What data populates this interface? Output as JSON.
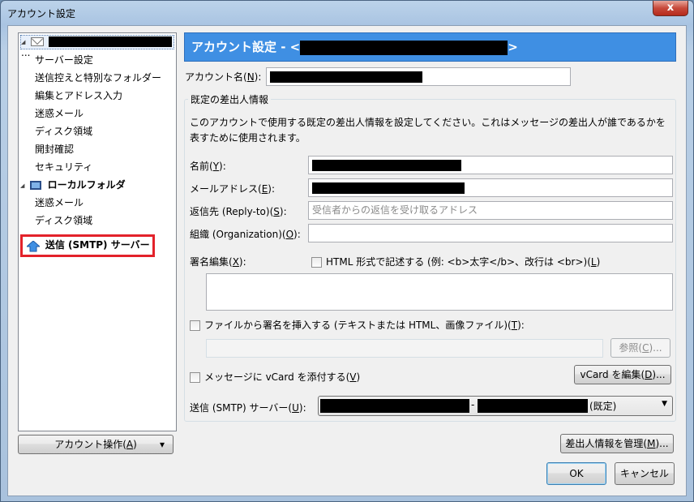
{
  "window": {
    "title": "アカウント設定",
    "close_glyph": "x"
  },
  "tree": {
    "account_ellipsis": "...",
    "account_children": [
      "サーバー設定",
      "送信控えと特別なフォルダー",
      "編集とアドレス入力",
      "迷惑メール",
      "ディスク領域",
      "開封確認",
      "セキュリティ"
    ],
    "local_folder": "ローカルフォルダ",
    "local_children": [
      "迷惑メール",
      "ディスク領域"
    ],
    "smtp": "送信 (SMTP) サーバー"
  },
  "header": {
    "prefix": "アカウント設定 - <",
    "suffix": ">"
  },
  "account_name": {
    "label_pre": "アカウント名(",
    "key": "N",
    "label_post": "):"
  },
  "identity": {
    "group_title": "既定の差出人情報",
    "description_1": "このアカウントで使用する既定の差出人情報を設定してください。これはメッセージの差出人が誰であるかを",
    "description_2": "表すために使用されます。",
    "name_pre": "名前(",
    "name_key": "Y",
    "name_post": "):",
    "email_pre": "メールアドレス(",
    "email_key": "E",
    "email_post": "):",
    "replyto_pre": "返信先 (Reply-to)(",
    "replyto_key": "S",
    "replyto_post": "):",
    "replyto_placeholder": "受信者からの返信を受け取るアドレス",
    "org_pre": "組織 (Organization)(",
    "org_key": "O",
    "org_post": "):",
    "sig_pre": "署名編集(",
    "sig_key": "X",
    "sig_post": "):",
    "html_pre": "HTML 形式で記述する (例: <b>太字</b>、改行は <br>)(",
    "html_key": "L",
    "html_post": ")",
    "file_sig_pre": "ファイルから署名を挿入する (テキストまたは HTML、画像ファイル)(",
    "file_sig_key": "T",
    "file_sig_post": "):",
    "browse_pre": "参照(",
    "browse_key": "C",
    "browse_post": ")...",
    "vcard_pre": "メッセージに vCard を添付する(",
    "vcard_key": "V",
    "vcard_post": ")",
    "vcard_edit_pre": "vCard を編集(",
    "vcard_edit_key": "D",
    "vcard_edit_post": ")...",
    "smtp_pre": "送信 (SMTP) サーバー(",
    "smtp_key": "U",
    "smtp_post": "):",
    "smtp_dash": "-",
    "smtp_default": "(既定)",
    "smtp_arrow": "▼"
  },
  "buttons": {
    "account_actions_pre": "アカウント操作(",
    "account_actions_key": "A",
    "account_actions_post": ")",
    "account_actions_arrow": "▾",
    "manage_pre": "差出人情報を管理(",
    "manage_key": "M",
    "manage_post": ")...",
    "ok": "OK",
    "cancel": "キャンセル"
  }
}
